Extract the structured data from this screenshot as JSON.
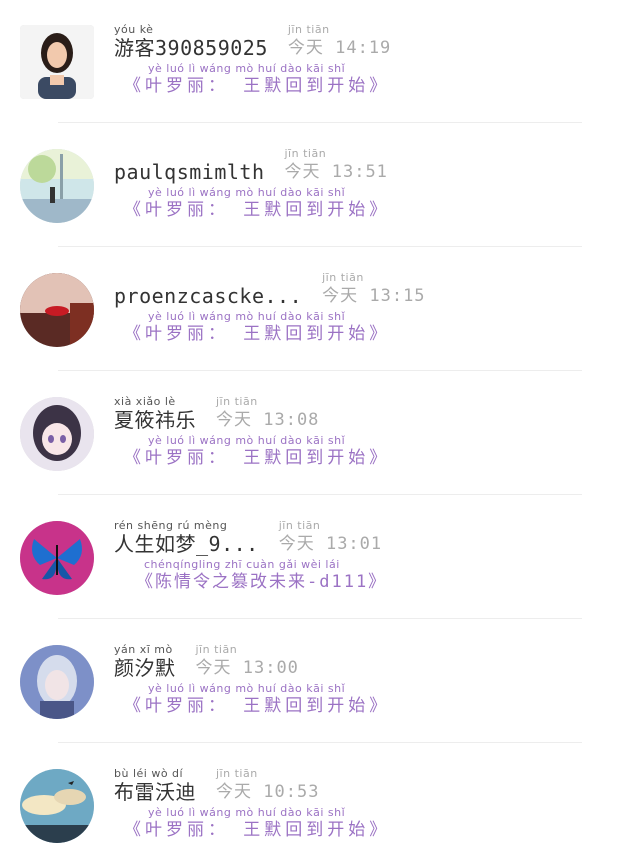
{
  "chats": [
    {
      "name_pinyin": "yóu kè",
      "name": "游客390859025",
      "time_pinyin": "jīn tiān",
      "time": "今天 14:19",
      "message_pinyin": "yè luó lì    wáng mò huí dào kāi shǐ",
      "message": "《叶罗丽： 王默回到开始》",
      "avatar_icon": "woman-portrait-avatar"
    },
    {
      "name_pinyin": "",
      "name": "paulqsmimlth",
      "time_pinyin": "jīn tiān",
      "time": "今天 13:51",
      "message_pinyin": "yè luó lì    wáng mò huí dào kāi shǐ",
      "message": "《叶罗丽： 王默回到开始》",
      "avatar_icon": "anime-street-avatar"
    },
    {
      "name_pinyin": "",
      "name": "proenzcascke...",
      "time_pinyin": "jīn tiān",
      "time": "今天 13:15",
      "message_pinyin": "yè luó lì    wáng mò huí dào kāi shǐ",
      "message": "《叶罗丽： 王默回到开始》",
      "avatar_icon": "red-lips-avatar"
    },
    {
      "name_pinyin": "xià xiǎo   lè",
      "name": "夏筱祎乐",
      "time_pinyin": "jīn tiān",
      "time": "今天 13:08",
      "message_pinyin": "yè luó lì    wáng mò huí dào kāi shǐ",
      "message": "《叶罗丽： 王默回到开始》",
      "avatar_icon": "anime-girl-avatar"
    },
    {
      "name_pinyin": "rén shēng rú mèng",
      "name": "人生如梦_9...",
      "time_pinyin": "jīn tiān",
      "time": "今天 13:01",
      "message_pinyin": "chénqíngling zhī cuàn gǎi wèi lái",
      "message": "《陈情令之篡改未来-d111》",
      "avatar_icon": "blue-butterfly-avatar"
    },
    {
      "name_pinyin": "yán xī mò",
      "name": "颜汐默",
      "time_pinyin": "jīn tiān",
      "time": "今天 13:00",
      "message_pinyin": "yè luó lì    wáng mò huí dào kāi shǐ",
      "message": "《叶罗丽： 王默回到开始》",
      "avatar_icon": "fantasy-girl-avatar"
    },
    {
      "name_pinyin": "bù léi wò dí",
      "name": "布雷沃迪",
      "time_pinyin": "jīn tiān",
      "time": "10:53",
      "time_prefix": "今天",
      "message_pinyin": "yè luó lì    wáng mò huí dào kāi shǐ",
      "message": "《叶罗丽： 王默回到开始》",
      "avatar_icon": "sky-landscape-avatar"
    }
  ],
  "colors": {
    "accent_purple": "#9b72c4",
    "name_text": "#333333",
    "time_text": "#aaaaaa",
    "divider": "#ededed"
  }
}
